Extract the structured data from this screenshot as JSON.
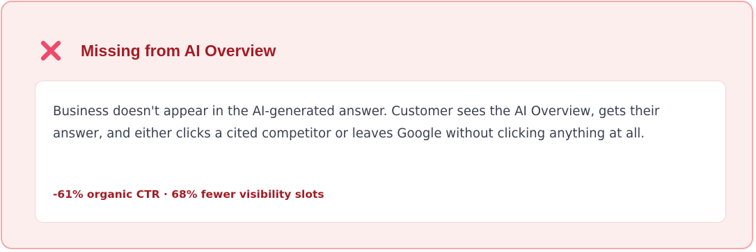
{
  "status": {
    "icon": "x-icon",
    "title": "Missing from AI Overview",
    "description": "Business doesn't appear in the AI-generated answer. Customer sees the AI Overview, gets their answer, and either clicks a cited competitor or leaves Google without clicking anything at all.",
    "stats": "-61% organic CTR · 68% fewer visibility slots"
  },
  "colors": {
    "accent": "#a31c25",
    "icon": "#ef4a6a",
    "card_background": "#fdeeee",
    "card_border": "#f4a9a9",
    "body_text": "#3a4150"
  }
}
